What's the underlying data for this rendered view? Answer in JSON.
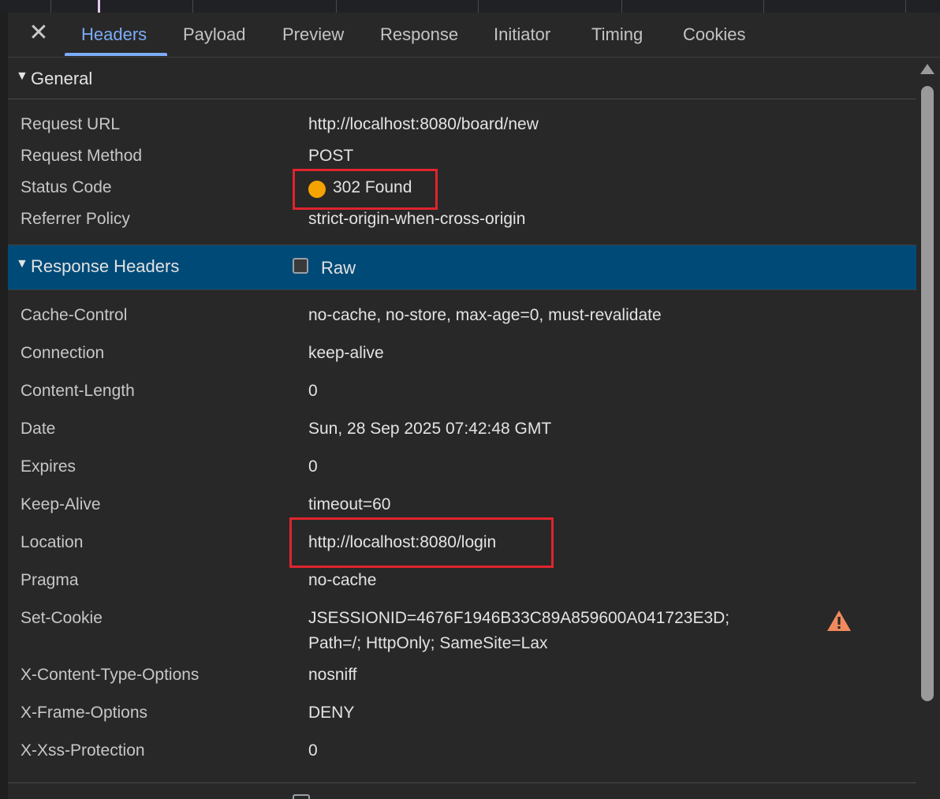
{
  "tabs": [
    {
      "label": "Headers",
      "active": true
    },
    {
      "label": "Payload"
    },
    {
      "label": "Preview"
    },
    {
      "label": "Response"
    },
    {
      "label": "Initiator"
    },
    {
      "label": "Timing"
    },
    {
      "label": "Cookies"
    }
  ],
  "close_glyph": "✕",
  "general": {
    "title": "General",
    "rows": [
      {
        "key": "Request URL",
        "value": "http://localhost:8080/board/new"
      },
      {
        "key": "Request Method",
        "value": "POST"
      },
      {
        "key": "Status Code",
        "value": "302 Found"
      },
      {
        "key": "Referrer Policy",
        "value": "strict-origin-when-cross-origin"
      }
    ]
  },
  "response_headers": {
    "title": "Response Headers",
    "raw_label": "Raw",
    "raw_checked": false,
    "rows": [
      {
        "key": "Cache-Control",
        "value": "no-cache, no-store, max-age=0, must-revalidate"
      },
      {
        "key": "Connection",
        "value": "keep-alive"
      },
      {
        "key": "Content-Length",
        "value": "0"
      },
      {
        "key": "Date",
        "value": "Sun, 28 Sep 2025 07:42:48 GMT"
      },
      {
        "key": "Expires",
        "value": "0"
      },
      {
        "key": "Keep-Alive",
        "value": "timeout=60"
      },
      {
        "key": "Location",
        "value": "http://localhost:8080/login"
      },
      {
        "key": "Pragma",
        "value": "no-cache"
      },
      {
        "key": "Set-Cookie",
        "value_line1": "JSESSIONID=4676F1946B33C89A859600A041723E3D;",
        "value_line2": "Path=/; HttpOnly; SameSite=Lax"
      },
      {
        "key": "X-Content-Type-Options",
        "value": "nosniff"
      },
      {
        "key": "X-Frame-Options",
        "value": "DENY"
      },
      {
        "key": "X-Xss-Protection",
        "value": "0"
      }
    ]
  },
  "colors": {
    "status_dot": "#f5a300",
    "highlight_border": "#e0242d",
    "active_tab": "#7cacf8",
    "section_selected": "#004a77",
    "warning": "#f08a5d"
  },
  "icons": {
    "close": "close-icon",
    "expand": "triangle-down-icon",
    "warning": "warning-icon"
  }
}
